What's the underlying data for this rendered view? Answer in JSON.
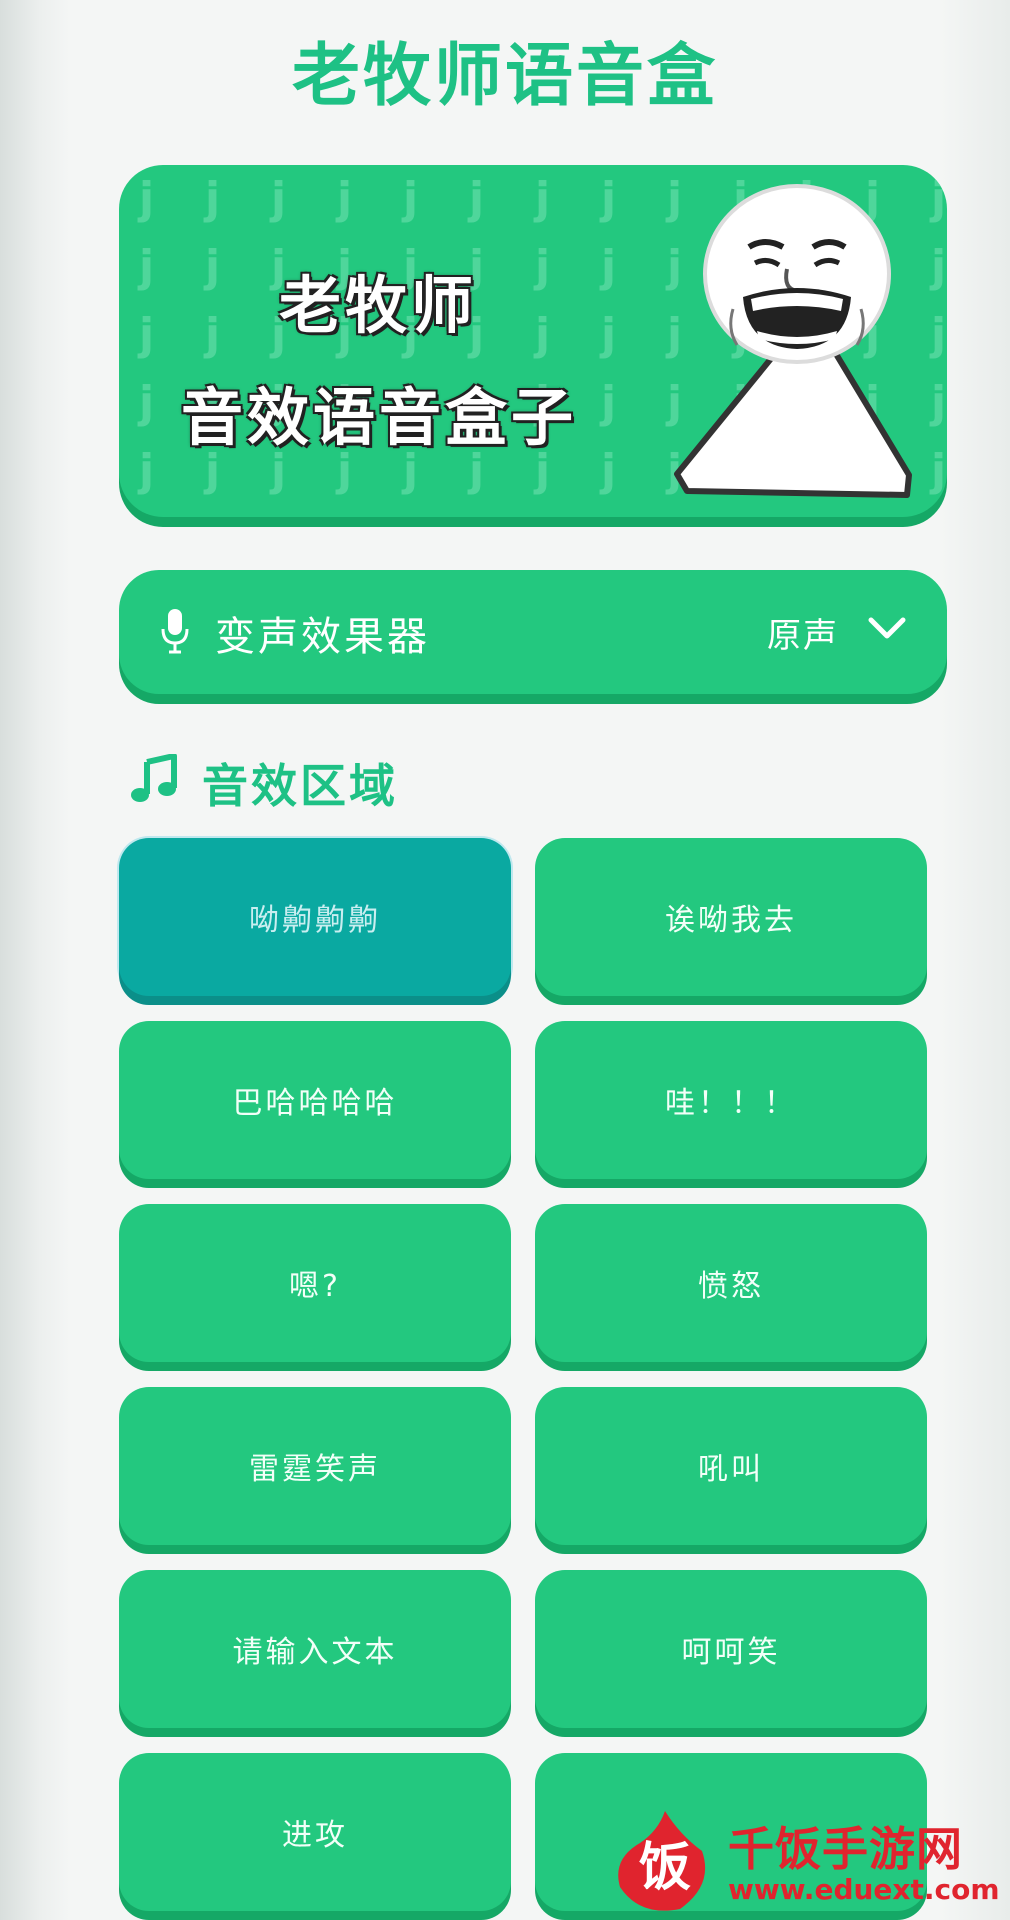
{
  "app": {
    "title": "老牧师语音盒"
  },
  "banner": {
    "line1": "老牧师",
    "line2": "音效语音盒子",
    "pattern_glyph": "j"
  },
  "voice_changer": {
    "icon": "mic-icon",
    "label": "变声效果器",
    "selected": "原声",
    "dropdown_icon": "chevron-down-icon"
  },
  "section": {
    "icon": "music-note-icon",
    "title": "音效区域"
  },
  "sounds": [
    {
      "label": "呦齁齁齁",
      "active": true
    },
    {
      "label": "诶呦我去",
      "active": false
    },
    {
      "label": "巴哈哈哈哈",
      "active": false
    },
    {
      "label": "哇！！！",
      "active": false
    },
    {
      "label": "嗯?",
      "active": false
    },
    {
      "label": "愤怒",
      "active": false
    },
    {
      "label": "雷霆笑声",
      "active": false
    },
    {
      "label": "吼叫",
      "active": false
    },
    {
      "label": "请输入文本",
      "active": false
    },
    {
      "label": "呵呵笑",
      "active": false
    },
    {
      "label": "进攻",
      "active": false
    },
    {
      "label": "",
      "active": false
    }
  ],
  "watermark": {
    "name": "千饭手游网",
    "url": "www.eduext.com",
    "logo_glyph": "饭"
  },
  "colors": {
    "primary": "#23c87f",
    "title_green": "#1ec185",
    "active_teal": "#0aa9a1",
    "watermark_red": "#e0242e"
  }
}
